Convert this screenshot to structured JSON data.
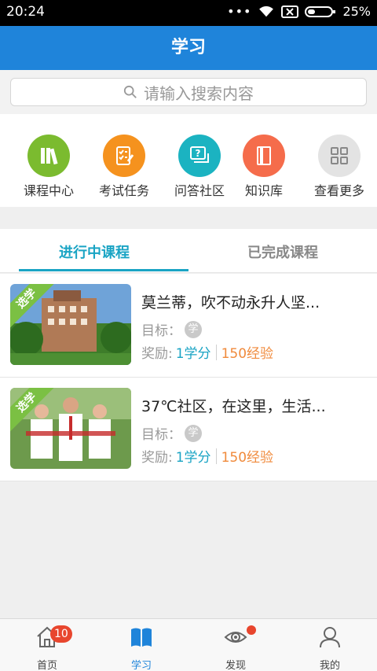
{
  "statusbar": {
    "time": "20:24",
    "battery": "25%"
  },
  "header": {
    "title": "学习"
  },
  "search": {
    "placeholder": "请输入搜索内容"
  },
  "quick_links": [
    {
      "label": "课程中心",
      "icon": "books-icon",
      "color": "#7bbb2f"
    },
    {
      "label": "考试任务",
      "icon": "checklist-icon",
      "color": "#f5921e"
    },
    {
      "label": "问答社区",
      "icon": "question-chat-icon",
      "color": "#1bb3c1"
    },
    {
      "label": "知识库",
      "icon": "library-book-icon",
      "color": "#f56c4b"
    },
    {
      "label": "查看更多",
      "icon": "grid-icon",
      "color": "#e3e3e3"
    }
  ],
  "tabs": [
    {
      "label": "进行中课程",
      "active": true
    },
    {
      "label": "已完成课程",
      "active": false
    }
  ],
  "courses": [
    {
      "ribbon": "选学",
      "title": "莫兰蒂，吹不动永升人坚...",
      "goal_label": "目标：",
      "goal_badge": "学",
      "reward_label": "奖励:",
      "credit": "1学分",
      "exp": "150经验"
    },
    {
      "ribbon": "选学",
      "title": "37℃社区，在这里，生活...",
      "goal_label": "目标：",
      "goal_badge": "学",
      "reward_label": "奖励:",
      "credit": "1学分",
      "exp": "150经验"
    }
  ],
  "bottom_nav": [
    {
      "label": "首页",
      "icon": "home-icon",
      "badge": "10"
    },
    {
      "label": "学习",
      "icon": "open-book-icon",
      "active": true
    },
    {
      "label": "发现",
      "icon": "eye-icon",
      "dot": true
    },
    {
      "label": "我的",
      "icon": "person-icon"
    }
  ],
  "colors": {
    "primary": "#1f84da",
    "teal": "#1aa4c4",
    "orange": "#f08a3b"
  }
}
